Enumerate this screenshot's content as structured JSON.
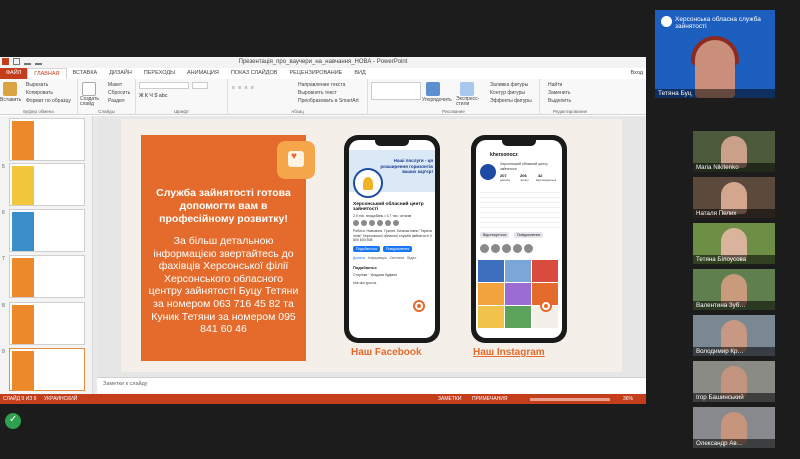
{
  "window": {
    "title": "Презентація_про_ваучери_на_навчання_НОВА - PowerPoint"
  },
  "tabs": [
    "ФАЙЛ",
    "ГЛАВНАЯ",
    "ВСТАВКА",
    "ДИЗАЙН",
    "ПЕРЕХОДЫ",
    "АНИМАЦИЯ",
    "ПОКАЗ СЛАЙДОВ",
    "РЕЦЕНЗИРОВАНИЕ",
    "ВИД"
  ],
  "login": "Вход",
  "ribbon": {
    "paste": "Вставить",
    "cut": "Вырезать",
    "copy": "Копировать",
    "format_painter": "Формат по образцу",
    "clipboard_group": "Буфер обмена",
    "new_slide": "Создать слайд",
    "layout": "Макет",
    "reset": "Сбросить",
    "section": "Раздел",
    "slides_group": "Слайды",
    "font_group": "Шрифт",
    "text_direction": "Направление текста",
    "align_text": "Выровнять текст",
    "smartart": "Преобразовать в SmartArt",
    "paragraph_group": "Абзац",
    "arrange": "Упорядочить",
    "quick_styles": "Экспресс-стили",
    "shape_fill": "Заливка фигуры",
    "shape_outline": "Контур фигуры",
    "shape_effects": "Эффекты фигуры",
    "drawing_group": "Рисование",
    "find": "Найти",
    "replace": "Заменить",
    "select": "Выделить",
    "editing_group": "Редактирование"
  },
  "thumbnails": [
    {
      "num": "",
      "color": "#ec8a2b"
    },
    {
      "num": "5",
      "color": "#f3c73d"
    },
    {
      "num": "6",
      "color": "#3a8ec9"
    },
    {
      "num": "7",
      "color": "#ec8a2b"
    },
    {
      "num": "8",
      "color": "#ec8a2b"
    },
    {
      "num": "9",
      "color": "#ec8a2b"
    }
  ],
  "slide": {
    "headline": "Служба зайнятості готова допомогти вам в професійному розвитку!",
    "body": "За більш детальною інформацією звертайтесь до фахівців Херсонської філії Херсонського обласного центру зайнятості Буцу Тетяни за номером 063 716 45 82 та Куник Тетяни за номером 095 841 60 46",
    "facebook_label": "Наш Facebook",
    "instagram_label": "Наш Instagram",
    "fb": {
      "cover_text": "Наші послуги - ця розширення горизонтів ваших кар'єр!",
      "name": "Херсонський обласний центр зайнятості",
      "stats": "2,9 тис. вподобань • 3,7 тис. читачів",
      "info": "Робота. Навчання. Гранти. Безкоштовно \"Гаряча лінія\" Херсонської обласної служби зайнятості 0 800 600 508",
      "like_btn": "Подобається",
      "msg_btn": "Повідомлення",
      "tabs": [
        "Дописи",
        "Інформація",
        "Світлини",
        "Відео"
      ],
      "likes_title": "Подобаєтьс",
      "page_item": "Сторінка · Урядова будівля",
      "site": "khe.dcz.gov.ua"
    },
    "ig": {
      "username": "khersonocz",
      "bio": "Херсонський обласний центр зайнятості",
      "posts": "207",
      "followers": "206",
      "following": "42",
      "posts_label": "дописи",
      "followers_label": "читачі",
      "following_label": "відстежуються",
      "follow_btn": "Відстежується",
      "msg_btn": "Повідомлення"
    }
  },
  "notes": "Заметки к слайду",
  "status": {
    "slide": "СЛАЙД 9 ИЗ 9",
    "lang": "УКРАИНСКИЙ",
    "notes": "ЗАМЕТКИ",
    "comments": "ПРИМЕЧАНИЯ",
    "zoom": "36%"
  },
  "host": {
    "org": "Херсонська обласна служба зайнятості",
    "name": "Тетяна Буц"
  },
  "participants": [
    {
      "name": "Maria Nikitenko",
      "bg": "#4c5a3b",
      "skin": "#caa08a"
    },
    {
      "name": "Наталя Пелих",
      "bg": "#5b4a3c",
      "skin": "#d2a78e"
    },
    {
      "name": "Тетяна Білоусова",
      "bg": "#6d8f45",
      "skin": "#d9b39b"
    },
    {
      "name": "Валентина Зуб…",
      "bg": "#5f7f4f",
      "skin": "#c99a7c"
    },
    {
      "name": "Володимир Кр…",
      "bg": "#7a8894",
      "skin": "#c79882"
    },
    {
      "name": "Ігор Башинський",
      "bg": "#8b8b86",
      "skin": "#c3957f"
    },
    {
      "name": "Олександр Ав…",
      "bg": "#88898c",
      "skin": "#c6957c"
    }
  ]
}
